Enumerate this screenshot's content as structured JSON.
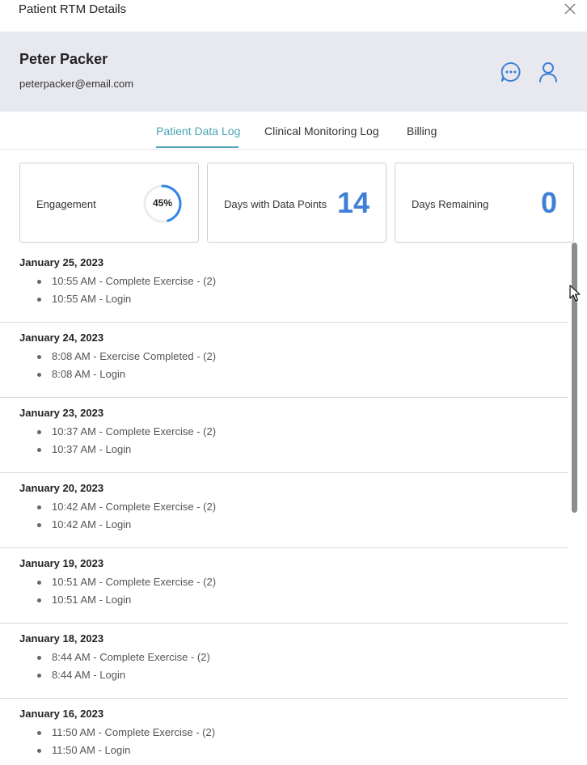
{
  "window": {
    "title": "Patient RTM Details"
  },
  "patient": {
    "name": "Peter Packer",
    "email": "peterpacker@email.com"
  },
  "icons": {
    "message": "chat-bubble-icon",
    "profile": "user-icon",
    "close": "close-icon"
  },
  "tabs": [
    {
      "label": "Patient Data Log",
      "active": true
    },
    {
      "label": "Clinical Monitoring Log",
      "active": false
    },
    {
      "label": "Billing",
      "active": false
    }
  ],
  "stats": {
    "engagement": {
      "label": "Engagement",
      "value": "45%",
      "fraction": 0.45
    },
    "days_with_data": {
      "label": "Days with Data Points",
      "value": "14"
    },
    "days_remaining": {
      "label": "Days Remaining",
      "value": "0"
    }
  },
  "colors": {
    "accent": "#4aa3b5",
    "number": "#3f7fd8",
    "gauge": "#2f86e6",
    "header_bg": "#e8e9ee"
  },
  "log": [
    {
      "date": "January 25, 2023",
      "entries": [
        "10:55 AM - Complete Exercise - (2)",
        "10:55 AM - Login"
      ]
    },
    {
      "date": "January 24, 2023",
      "entries": [
        "8:08 AM - Exercise Completed - (2)",
        "8:08 AM - Login"
      ]
    },
    {
      "date": "January 23, 2023",
      "entries": [
        "10:37 AM - Complete Exercise - (2)",
        "10:37 AM - Login"
      ]
    },
    {
      "date": "January 20, 2023",
      "entries": [
        "10:42 AM - Complete Exercise - (2)",
        "10:42 AM - Login"
      ]
    },
    {
      "date": "January 19, 2023",
      "entries": [
        "10:51 AM - Complete Exercise - (2)",
        "10:51 AM - Login"
      ]
    },
    {
      "date": "January 18, 2023",
      "entries": [
        "8:44 AM - Complete Exercise - (2)",
        "8:44 AM - Login"
      ]
    },
    {
      "date": "January 16, 2023",
      "entries": [
        "11:50 AM - Complete Exercise - (2)",
        "11:50 AM - Login"
      ]
    }
  ]
}
